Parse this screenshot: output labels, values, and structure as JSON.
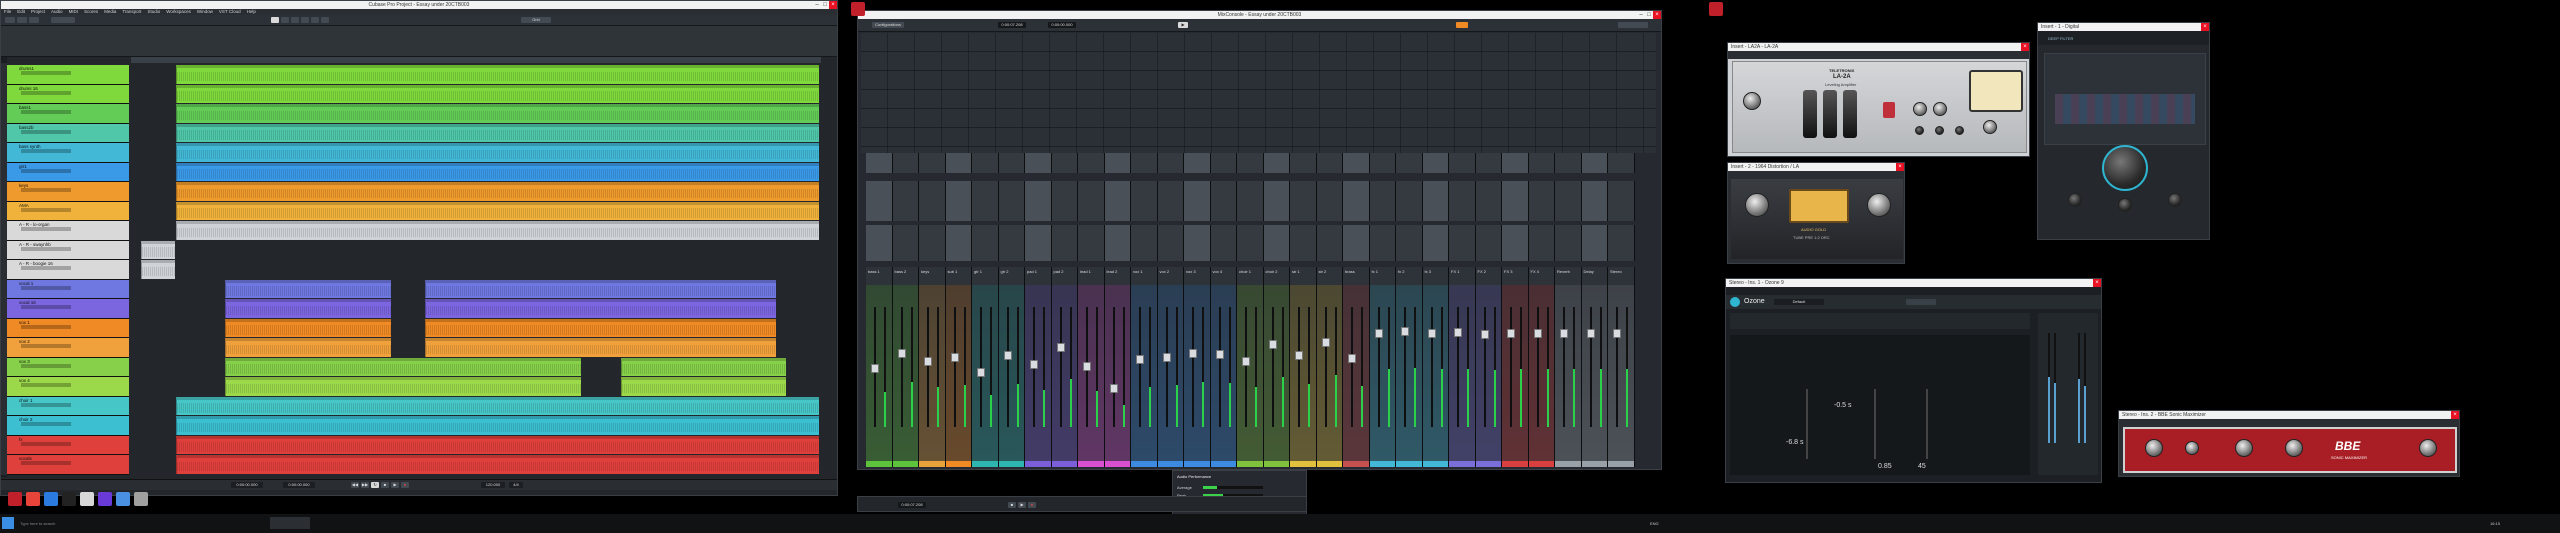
{
  "cubase_window": {
    "title": "Cubase Pro Project - Essay under 20CTB003",
    "title_right": "Cubase Pro",
    "menu": [
      "File",
      "Edit",
      "Project",
      "Audio",
      "MIDI",
      "Scores",
      "Media",
      "Transport",
      "Studio",
      "Workspaces",
      "Window",
      "VST Cloud",
      "Help"
    ],
    "tracks": [
      {
        "name": "drums1",
        "color": "#7fd83c"
      },
      {
        "name": "drums 16",
        "color": "#7fd83c"
      },
      {
        "name": "bass1",
        "color": "#62cc57"
      },
      {
        "name": "bass2b",
        "color": "#4fc7a8"
      },
      {
        "name": "bass synth",
        "color": "#43b8d6"
      },
      {
        "name": "gtr1",
        "color": "#3b9ae8"
      },
      {
        "name": "keys",
        "color": "#ef9a2c"
      },
      {
        "name": "AMA",
        "color": "#f0b23a"
      },
      {
        "name": "A - R - lo-organ",
        "color": "#d9d9d9"
      },
      {
        "name": "A - R - swaynhb",
        "color": "#d9d9d9"
      },
      {
        "name": "A - R - boogie 16",
        "color": "#d9d9d9"
      },
      {
        "name": "vocal 1",
        "color": "#6e78e0"
      },
      {
        "name": "vocal 16",
        "color": "#7c66e0"
      },
      {
        "name": "vox 1",
        "color": "#f08a24"
      },
      {
        "name": "vox 2",
        "color": "#f0a13b"
      },
      {
        "name": "vox 3",
        "color": "#87d04a"
      },
      {
        "name": "vox 4",
        "color": "#9bd94a"
      },
      {
        "name": "choir 1",
        "color": "#47c6c7"
      },
      {
        "name": "choir 2",
        "color": "#3bbfd1"
      },
      {
        "name": "fx",
        "color": "#e0403c"
      },
      {
        "name": "vocals",
        "color": "#e0403c"
      }
    ],
    "status": {
      "position": "0:00:00.000",
      "time": "0:00:00.000",
      "tempo": "120.000",
      "sig": "4/4",
      "zoom": "Grid"
    }
  },
  "mixer_window": {
    "title": "MixConsole - Essay under 20CTB003",
    "config_label": "Configurations",
    "position": "0:00:07.208",
    "end": "0:00:00.000",
    "channel_labels": [
      "bass 1",
      "bass 2",
      "keys",
      "sub 1",
      "gtr 1",
      "gtr 2",
      "pad 1",
      "pad 2",
      "lead 1",
      "lead 2",
      "vox 1",
      "vox 2",
      "vox 3",
      "vox 4",
      "choir 1",
      "choir 2",
      "str 1",
      "str 2",
      "brass",
      "fx 1",
      "fx 2",
      "fx 3",
      "FX 1",
      "FX 2",
      "FX 3",
      "FX 4",
      "Reverb",
      "Delay",
      "Stereo"
    ],
    "channel_colors": [
      "#5ec33c",
      "#5ec33c",
      "#e8a23b",
      "#f08a24",
      "#2fb5b0",
      "#2fb5b0",
      "#7b5fd8",
      "#7b5fd8",
      "#d84fd0",
      "#d84fd0",
      "#3c8be0",
      "#3c8be0",
      "#3c8be0",
      "#3c8be0",
      "#7fc03c",
      "#7fc03c",
      "#e0c03c",
      "#e0c03c",
      "#c45050",
      "#43b8d6",
      "#43b8d6",
      "#43b8d6",
      "#7a6fd8",
      "#7a6fd8",
      "#d84040",
      "#d84040",
      "#9aa0a8",
      "#9aa0a8",
      "#9aa0a8"
    ],
    "fader_levels": [
      0.48,
      0.62,
      0.55,
      0.58,
      0.45,
      0.6,
      0.52,
      0.67,
      0.5,
      0.3,
      0.56,
      0.58,
      0.62,
      0.61,
      0.55,
      0.7,
      0.6,
      0.72,
      0.57,
      0.8,
      0.82,
      0.8,
      0.81,
      0.79,
      0.8,
      0.8,
      0.8,
      0.8,
      0.8
    ]
  },
  "performance_panel": {
    "title": "Audio Performance",
    "rows": [
      "Average",
      "Peak",
      "Overload"
    ]
  },
  "plugins": {
    "la2a": {
      "title": "Insert - LA2A - LA-2A",
      "brand": "TELETRONIX",
      "model": "LA-2A",
      "subtitle": "Leveling Amplifier"
    },
    "filter": {
      "title": "Insert - 1 - Digital",
      "label": "DEEP FILTER"
    },
    "tape": {
      "title": "Insert - 2 - 1964 Distortion / LA",
      "label": "AUDIO GOLD",
      "sub": "TUBE PRE  1:2  ORC"
    },
    "ozone": {
      "title": "Stereo - Ins. 1 - Ozone 9",
      "name": "Ozone",
      "preset": "Default",
      "values": [
        "-0.5 s",
        "-6.8 s",
        "0.85",
        "45"
      ]
    },
    "bbe": {
      "title": "Stereo - Ins. 2 - BBE Sonic Maximizer",
      "brand": "BBE",
      "model": "SONIC MAXIMIZER"
    }
  },
  "taskbar": {
    "search": "Type here to search",
    "time": "16:15",
    "tray": "ENG"
  }
}
